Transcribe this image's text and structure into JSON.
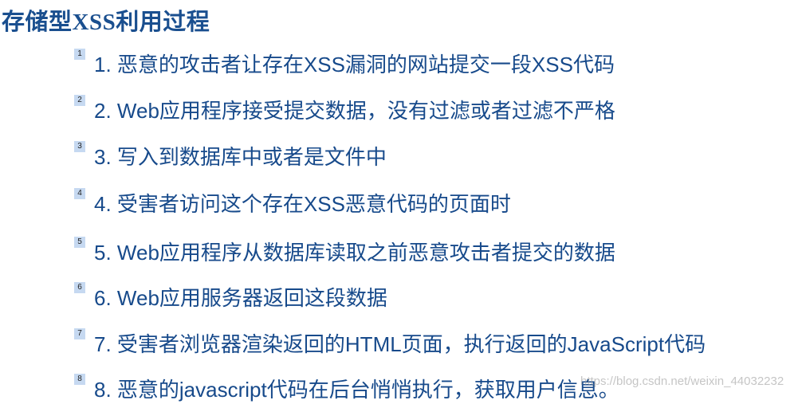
{
  "title": "存储型XSS利用过程",
  "items": [
    {
      "badge": "1",
      "text": "1. 恶意的攻击者让存在XSS漏洞的网站提交一段XSS代码"
    },
    {
      "badge": "2",
      "text": "2. Web应用程序接受提交数据，没有过滤或者过滤不严格"
    },
    {
      "badge": "3",
      "text": "3. 写入到数据库中或者是文件中"
    },
    {
      "badge": "4",
      "text": "4. 受害者访问这个存在XSS恶意代码的页面时"
    },
    {
      "badge": "5",
      "text": "5. Web应用程序从数据库读取之前恶意攻击者提交的数据"
    },
    {
      "badge": "6",
      "text": "6. Web应用服务器返回这段数据"
    },
    {
      "badge": "7",
      "text": "7. 受害者浏览器渲染返回的HTML页面，执行返回的JavaScript代码"
    },
    {
      "badge": "8",
      "text": "8. 恶意的javascript代码在后台悄悄执行，获取用户信息。"
    }
  ],
  "watermark": "https://blog.csdn.net/weixin_44032232"
}
